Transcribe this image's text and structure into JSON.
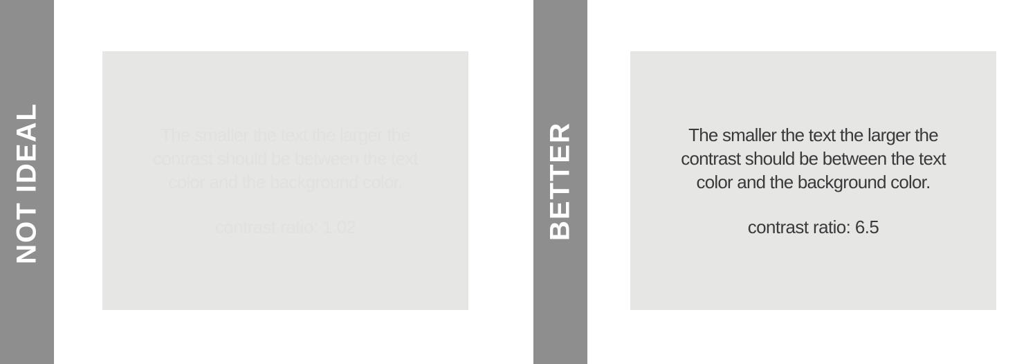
{
  "left_panel": {
    "label": "NOT IDEAL",
    "text_lines": [
      "The smaller the text the larger the",
      "contrast should be between the text",
      "color and the background color."
    ],
    "ratio_text": "contrast ratio: 1.02"
  },
  "right_panel": {
    "label": "BETTER",
    "text_lines": [
      "The smaller the text the larger the",
      "contrast should be between the text",
      "color and the background color."
    ],
    "ratio_text": "contrast ratio: 6.5"
  },
  "colors": {
    "bar": "#8e8e8e",
    "box_background": "#e6e6e5",
    "low_contrast_text": "#e1e1e0",
    "high_contrast_text": "#3a3a3a",
    "label_text": "#ffffff"
  }
}
